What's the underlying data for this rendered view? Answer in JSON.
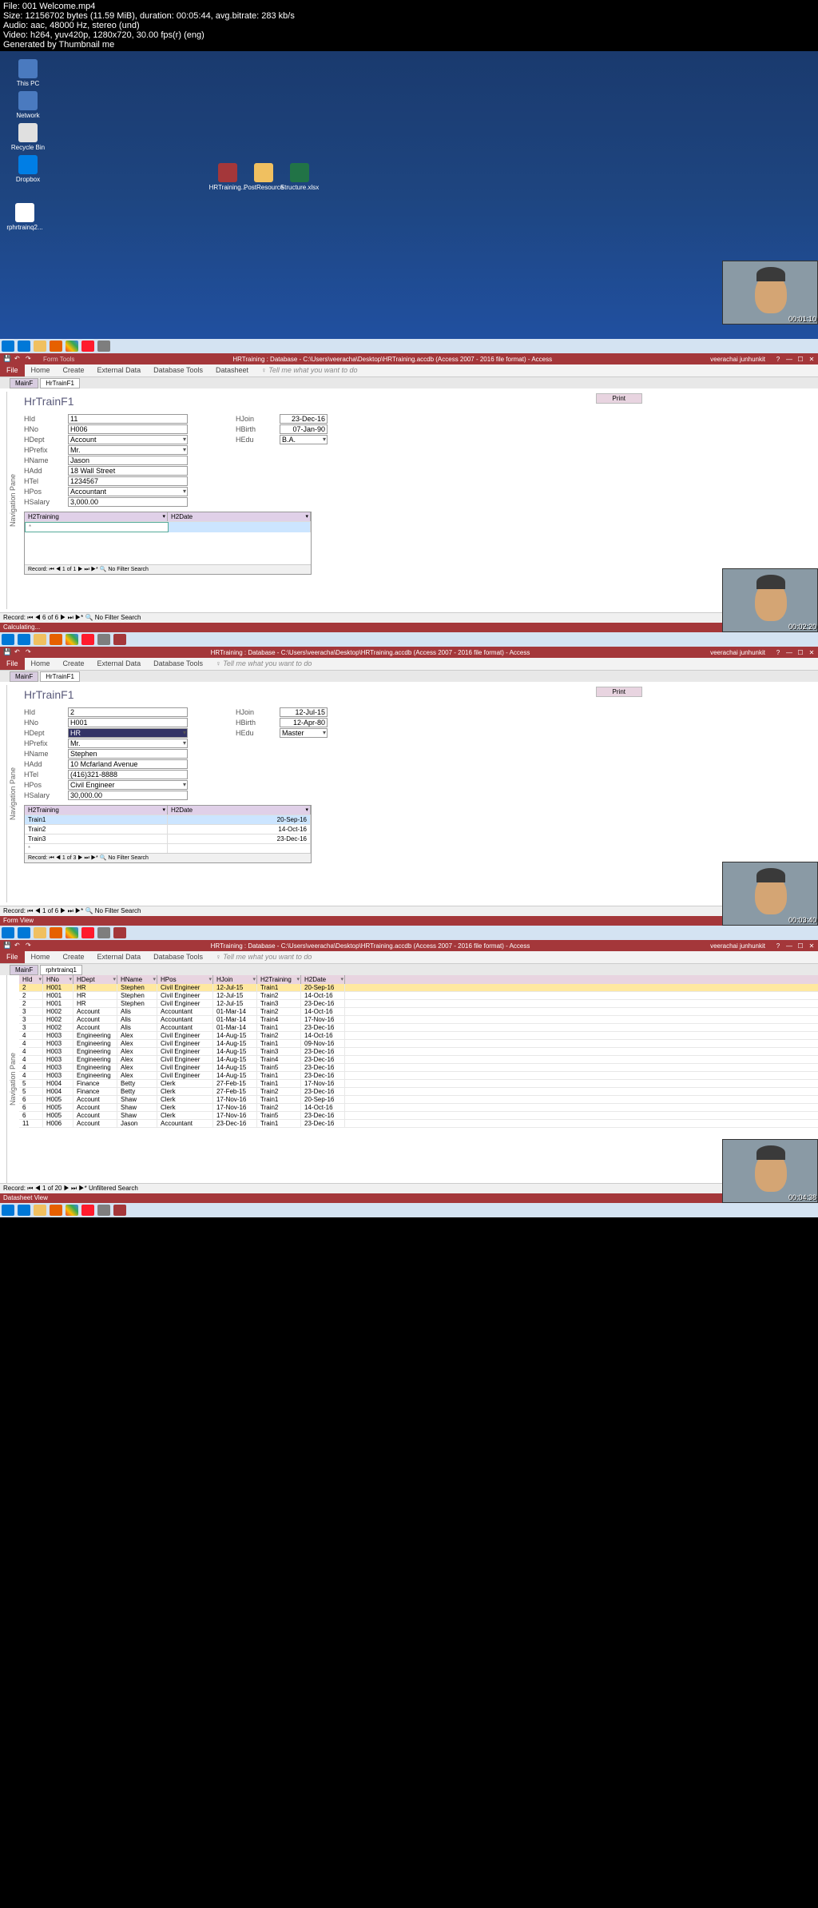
{
  "meta": {
    "file": "File: 001 Welcome.mp4",
    "size": "Size: 12156702 bytes (11.59 MiB), duration: 00:05:44, avg.bitrate: 283 kb/s",
    "audio": "Audio: aac, 48000 Hz, stereo (und)",
    "video": "Video: h264, yuv420p, 1280x720, 30.00 fps(r) (eng)",
    "gen": "Generated by Thumbnail me"
  },
  "desktop": {
    "icons": {
      "thispc": "This PC",
      "network": "Network",
      "recycle": "Recycle Bin",
      "dropbox": "Dropbox",
      "hrtraining": "HRTraining...",
      "postresource": "PostResource",
      "structure": "Structure.xlsx",
      "rphr": "rphrtrainq2..."
    },
    "ts1": "00:01:10"
  },
  "access": {
    "title": "HRTraining : Database - C:\\Users\\veeracha\\Desktop\\HRTraining.accdb (Access 2007 - 2016 file format) - Access",
    "user": "veerachai junhunkit",
    "ribbon": {
      "file": "File",
      "home": "Home",
      "create": "Create",
      "external": "External Data",
      "dbtools": "Database Tools",
      "datasheet": "Datasheet",
      "tellme": "♀ Tell me what you want to do"
    },
    "tabs": {
      "mainf": "MainF",
      "hrtrainf1": "HrTrainF1",
      "rphr": "rphrtrainq1"
    },
    "formtitle": "HrTrainF1",
    "print": "Print",
    "navpane": "Navigation Pane",
    "labels": {
      "hid": "HId",
      "hno": "HNo",
      "hdept": "HDept",
      "hprefix": "HPrefix",
      "hname": "HName",
      "hadd": "HAdd",
      "htel": "HTel",
      "hpos": "HPos",
      "hsalary": "HSalary",
      "hjoin": "HJoin",
      "hbirth": "HBirth",
      "hedu": "HEdu",
      "h2train": "H2Training",
      "h2date": "H2Date"
    }
  },
  "form1": {
    "hid": "11",
    "hno": "H006",
    "hdept": "Account",
    "hprefix": "Mr.",
    "hname": "Jason",
    "hadd": "18 Wall Street",
    "htel": "1234567",
    "hpos": "Accountant",
    "hsalary": "3,000.00",
    "hjoin": "23-Dec-16",
    "hbirth": "07-Jan-90",
    "hedu": "B.A.",
    "subnav": "Record: ⏮ ◀ 1 of 1 ▶ ⏭ ▶* 🔍 No Filter Search",
    "recnav": "Record: ⏮ ◀ 6 of 6 ▶ ⏭ ▶* 🔍 No Filter Search",
    "status": "Calculating...",
    "ts": "00:02:20"
  },
  "form2": {
    "hid": "2",
    "hno": "H001",
    "hdept": "HR",
    "hprefix": "Mr.",
    "hname": "Stephen",
    "hadd": "10 Mcfarland Avenue",
    "htel": "(416)321-8888",
    "hpos": "Civil Engineer",
    "hsalary": "30,000.00",
    "hjoin": "12-Jul-15",
    "hbirth": "12-Apr-80",
    "hedu": "Master",
    "sub": [
      {
        "t": "Train1",
        "d": "20-Sep-16"
      },
      {
        "t": "Train2",
        "d": "14-Oct-16"
      },
      {
        "t": "Train3",
        "d": "23-Dec-16"
      }
    ],
    "subnav": "Record: ⏮ ◀ 1 of 3 ▶ ⏭ ▶* 🔍 No Filter Search",
    "recnav": "Record: ⏮ ◀ 1 of 6 ▶ ⏭ ▶* 🔍 No Filter Search",
    "status": "Form View",
    "ts": "00:03:40"
  },
  "ds": {
    "headers": [
      "HId",
      "HNo",
      "HDept",
      "HName",
      "HPos",
      "HJoin",
      "H2Training",
      "H2Date"
    ],
    "rows": [
      [
        "2",
        "H001",
        "HR",
        "Stephen",
        "Civil Engineer",
        "12-Jul-15",
        "Train1",
        "20-Sep-16"
      ],
      [
        "2",
        "H001",
        "HR",
        "Stephen",
        "Civil Engineer",
        "12-Jul-15",
        "Train2",
        "14-Oct-16"
      ],
      [
        "2",
        "H001",
        "HR",
        "Stephen",
        "Civil Engineer",
        "12-Jul-15",
        "Train3",
        "23-Dec-16"
      ],
      [
        "3",
        "H002",
        "Account",
        "Alis",
        "Accountant",
        "01-Mar-14",
        "Train2",
        "14-Oct-16"
      ],
      [
        "3",
        "H002",
        "Account",
        "Alis",
        "Accountant",
        "01-Mar-14",
        "Train4",
        "17-Nov-16"
      ],
      [
        "3",
        "H002",
        "Account",
        "Alis",
        "Accountant",
        "01-Mar-14",
        "Train1",
        "23-Dec-16"
      ],
      [
        "4",
        "H003",
        "Engineering",
        "Alex",
        "Civil Engineer",
        "14-Aug-15",
        "Train2",
        "14-Oct-16"
      ],
      [
        "4",
        "H003",
        "Engineering",
        "Alex",
        "Civil Engineer",
        "14-Aug-15",
        "Train1",
        "09-Nov-16"
      ],
      [
        "4",
        "H003",
        "Engineering",
        "Alex",
        "Civil Engineer",
        "14-Aug-15",
        "Train3",
        "23-Dec-16"
      ],
      [
        "4",
        "H003",
        "Engineering",
        "Alex",
        "Civil Engineer",
        "14-Aug-15",
        "Train4",
        "23-Dec-16"
      ],
      [
        "4",
        "H003",
        "Engineering",
        "Alex",
        "Civil Engineer",
        "14-Aug-15",
        "Train5",
        "23-Dec-16"
      ],
      [
        "4",
        "H003",
        "Engineering",
        "Alex",
        "Civil Engineer",
        "14-Aug-15",
        "Train1",
        "23-Dec-16"
      ],
      [
        "5",
        "H004",
        "Finance",
        "Betty",
        "Clerk",
        "27-Feb-15",
        "Train1",
        "17-Nov-16"
      ],
      [
        "5",
        "H004",
        "Finance",
        "Betty",
        "Clerk",
        "27-Feb-15",
        "Train2",
        "23-Dec-16"
      ],
      [
        "6",
        "H005",
        "Account",
        "Shaw",
        "Clerk",
        "17-Nov-16",
        "Train1",
        "20-Sep-16"
      ],
      [
        "6",
        "H005",
        "Account",
        "Shaw",
        "Clerk",
        "17-Nov-16",
        "Train2",
        "14-Oct-16"
      ],
      [
        "6",
        "H005",
        "Account",
        "Shaw",
        "Clerk",
        "17-Nov-16",
        "Train5",
        "23-Dec-16"
      ],
      [
        "11",
        "H006",
        "Account",
        "Jason",
        "Accountant",
        "23-Dec-16",
        "Train1",
        "23-Dec-16"
      ]
    ],
    "recnav": "Record: ⏮ ◀ 1 of 20 ▶ ⏭ ▶* Unfiltered Search",
    "status": "Datasheet View",
    "ts": "00:04:38"
  }
}
